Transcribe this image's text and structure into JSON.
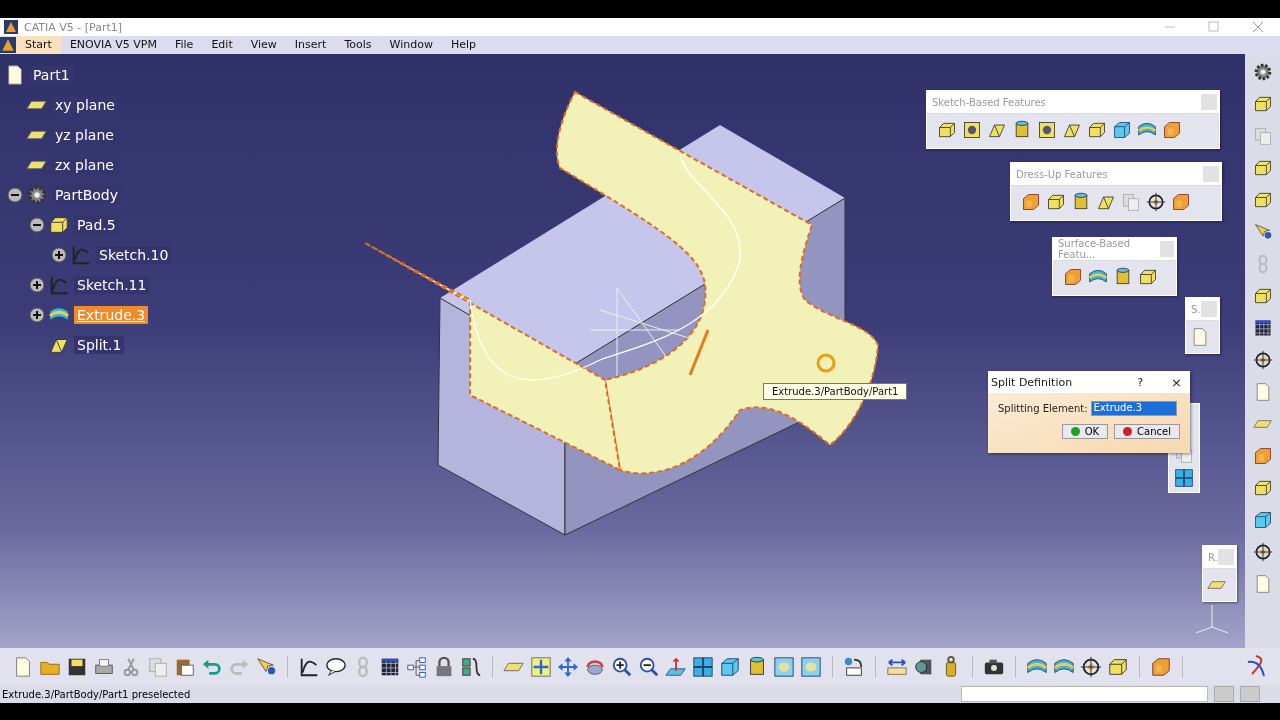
{
  "window": {
    "title": "CATIA V5 - [Part1]"
  },
  "menu": [
    {
      "label": "Start",
      "selected": true
    },
    {
      "label": "ENOVIA V5 VPM",
      "selected": false
    },
    {
      "label": "File",
      "selected": false
    },
    {
      "label": "Edit",
      "selected": false
    },
    {
      "label": "View",
      "selected": false
    },
    {
      "label": "Insert",
      "selected": false
    },
    {
      "label": "Tools",
      "selected": false
    },
    {
      "label": "Window",
      "selected": false
    },
    {
      "label": "Help",
      "selected": false
    }
  ],
  "tree": {
    "items": [
      {
        "label": "Part1",
        "kind": "part",
        "selected": false,
        "children": [
          {
            "label": "xy plane",
            "kind": "plane",
            "selected": false
          },
          {
            "label": "yz plane",
            "kind": "plane",
            "selected": false
          },
          {
            "label": "zx plane",
            "kind": "plane",
            "selected": false
          },
          {
            "label": "PartBody",
            "kind": "body",
            "selected": false,
            "expanded": true,
            "children": [
              {
                "label": "Pad.5",
                "kind": "pad",
                "selected": false,
                "expanded": true,
                "children": [
                  {
                    "label": "Sketch.10",
                    "kind": "sketch",
                    "selected": false,
                    "expanded": false
                  }
                ]
              },
              {
                "label": "Sketch.11",
                "kind": "sketch",
                "selected": false,
                "expanded": false
              },
              {
                "label": "Extrude.3",
                "kind": "extrude",
                "selected": true,
                "expanded": false
              },
              {
                "label": "Split.1",
                "kind": "split",
                "selected": false
              }
            ]
          }
        ]
      }
    ]
  },
  "toolbars": [
    {
      "title": "Sketch-Based Features"
    },
    {
      "title": "Dress-Up Features"
    },
    {
      "title": "Surface-Based Featu..."
    },
    {
      "title": "S."
    },
    {
      "title": "R."
    }
  ],
  "tooltip": "Extrude.3/PartBody/Part1",
  "dialog": {
    "title": "Split Definition",
    "help": "?",
    "close": "×",
    "label": "Splitting Element:",
    "value": "Extrude.3",
    "buttons": [
      {
        "label": "OK",
        "kind": "ok"
      },
      {
        "label": "Cancel",
        "kind": "cancel"
      }
    ]
  },
  "status_bar": {
    "message": "Extrude.3/PartBody/Part1 preselected"
  }
}
